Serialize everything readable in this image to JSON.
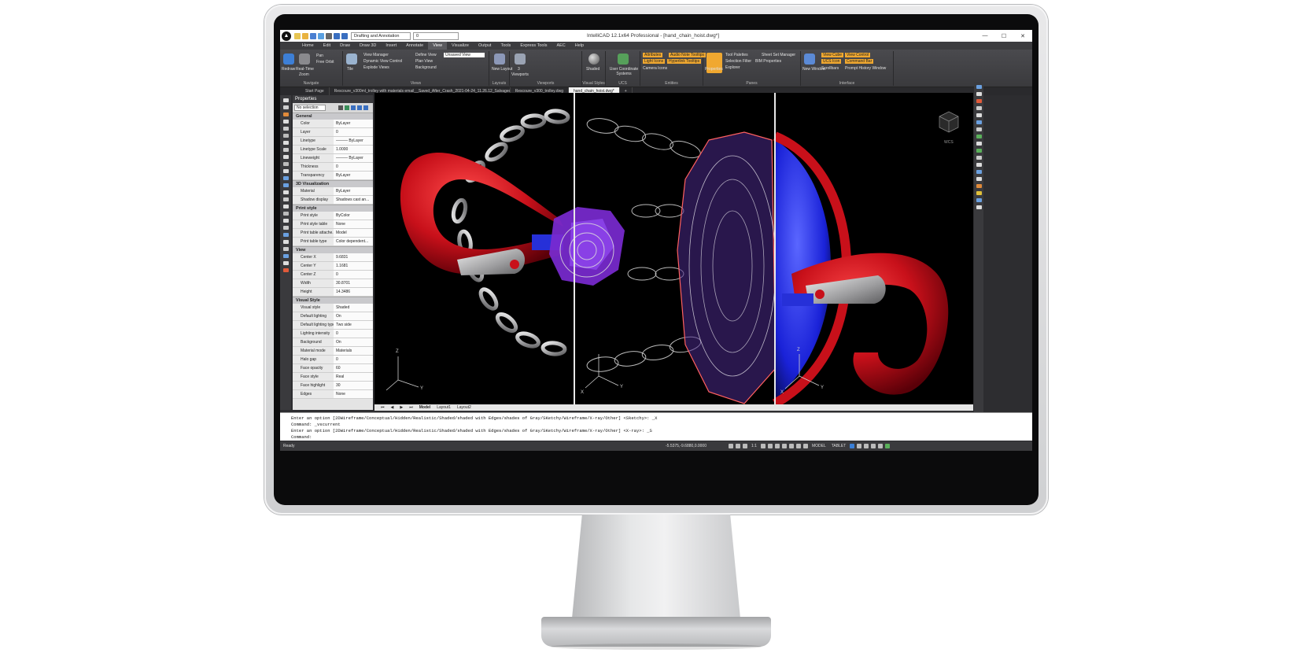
{
  "app": {
    "title": "IntelliCAD 12.1x64 Professional - [hand_chain_hoist.dwg*]",
    "logo_glyph": "▲",
    "workspace": "Drafting and Annotation",
    "layer": "0"
  },
  "window_controls": [
    "—",
    "☐",
    "✕"
  ],
  "menu_tabs": [
    "Home",
    "Edit",
    "Draw",
    "Draw 3D",
    "Insert",
    "Annotate",
    "View",
    "Visualize",
    "Output",
    "Tools",
    "Express Tools",
    "AEC",
    "Help"
  ],
  "active_menu_tab": "View",
  "ribbon": {
    "navigate": {
      "label": "Navigate",
      "redraw": "Redraw",
      "realtime": "Real-Time",
      "zoom": "Zoom",
      "pan": "Pan",
      "free_orbit": "Free Orbit"
    },
    "views": {
      "label": "Views",
      "tile": "Tile",
      "view_manager": "View Manager",
      "dynamic_view_control": "Dynamic View Control",
      "explode_views": "Explode Views",
      "define_view": "Define View",
      "plan_view": "Plan View",
      "background": "Background",
      "unsaved_view": "Unsaved View"
    },
    "layouts": {
      "label": "Layouts",
      "new_layout": "New Layout"
    },
    "viewports": {
      "label": "Viewports",
      "viewports": "Viewports",
      "count": "3"
    },
    "visual_styles": {
      "label": "Visual Styles",
      "shaded": "Shaded"
    },
    "ucs": {
      "label": "UCS",
      "user_coordinate_systems": "User Coordinate Systems"
    },
    "entities": {
      "label": "Entities",
      "attributes": "Attributes",
      "audio_note_tooltips": "Audio Note Tooltips",
      "light_icons": "Light Icons",
      "hyperlink_tooltips": "Hyperlink Tooltips",
      "camera_icons": "Camera Icons"
    },
    "panes": {
      "label": "Panes",
      "properties": "Properties",
      "tool_palettes": "Tool Palettes",
      "selection_filter": "Selection Filter",
      "explorer": "Explorer",
      "sheet_set_manager": "Sheet Set Manager",
      "bim_properties": "BIM Properties"
    },
    "interface": {
      "label": "Interface",
      "new_window": "New Window",
      "view_cube": "View Cube",
      "view_control": "View Control",
      "ucs_icon": "UCS Icon",
      "command_bar": "Command Bar",
      "scrollbars": "Scrollbars",
      "prompt_history_window": "Prompt History Window"
    }
  },
  "doc_tabs": [
    "Start Page",
    "Rescoure_v300ml_trolley with materials email__Saved_After_Crash_2021-04-24_11.26.12_Salvaged.dwg*",
    "Rescoure_v300_trolley.dwg",
    "hand_chain_hoist.dwg*"
  ],
  "active_doc_tab": "hand_chain_hoist.dwg*",
  "properties": {
    "title": "Properties",
    "selection": "No selection",
    "sections": [
      {
        "name": "General",
        "rows": [
          [
            "Color",
            "ByLayer"
          ],
          [
            "Layer",
            "0"
          ],
          [
            "Linetype",
            "——— ByLayer"
          ],
          [
            "Linetype Scale",
            "1.0000"
          ],
          [
            "Lineweight",
            "——— ByLayer"
          ],
          [
            "Thickness",
            "0"
          ],
          [
            "Transparency",
            "ByLayer"
          ]
        ]
      },
      {
        "name": "3D Visualization",
        "rows": [
          [
            "Material",
            "ByLayer"
          ],
          [
            "Shadow display",
            "Shadows cast an..."
          ]
        ]
      },
      {
        "name": "Print style",
        "rows": [
          [
            "Print style",
            "ByColor"
          ],
          [
            "Print style table",
            "None"
          ],
          [
            "Print table attache...",
            "Model"
          ],
          [
            "Print table type",
            "Color dependent..."
          ]
        ]
      },
      {
        "name": "View",
        "rows": [
          [
            "Center X",
            "9.6831"
          ],
          [
            "Center Y",
            "1.1681"
          ],
          [
            "Center Z",
            "0"
          ],
          [
            "Width",
            "30.8701"
          ],
          [
            "Height",
            "14.3486"
          ]
        ]
      },
      {
        "name": "Visual Style",
        "rows": [
          [
            "Visual style",
            "Shaded"
          ],
          [
            "Default lighting",
            "On"
          ],
          [
            "Default lighting type",
            "Two side"
          ],
          [
            "Lighting intensity",
            "0"
          ],
          [
            "Background",
            "On"
          ],
          [
            "Material mode",
            "Materials"
          ],
          [
            "Halo gap",
            "0"
          ],
          [
            "Face opacity",
            "60"
          ],
          [
            "Face style",
            "Real"
          ],
          [
            "Face highlight",
            "30"
          ],
          [
            "Edges",
            "None"
          ]
        ]
      }
    ]
  },
  "layout_tabs": [
    "Model",
    "Layout1",
    "Layout2"
  ],
  "active_layout_tab": "Model",
  "axes": {
    "z": "Z",
    "y": "Y",
    "x": "X"
  },
  "viewport_labels": {
    "cube_label": "WCS"
  },
  "command_history": [
    "Enter an option [2DWireframe/Conceptual/Hidden/Realistic/Shaded/shaded with Edges/shades of Gray/SKetchy/Wireframe/X-ray/Other] <Sketchy>: _X",
    "Command: _vscurrent",
    "Enter an option [2DWireframe/Conceptual/Hidden/Realistic/Shaded/shaded with Edges/shades of Gray/SKetchy/Wireframe/X-ray/Other] <X-ray>: _S",
    "Command:"
  ],
  "status": {
    "ready": "Ready",
    "coords": "-5.5375,-9.6880,0.0000",
    "scale": "1:1",
    "model": "MODEL",
    "tablet": "TABLET"
  },
  "colors": {
    "hook_red": "#c8101a",
    "chain_gray": "#b9b9bb",
    "violet": "#7a2ad0",
    "blue": "#1a22d8",
    "accent": "#f0a830"
  }
}
